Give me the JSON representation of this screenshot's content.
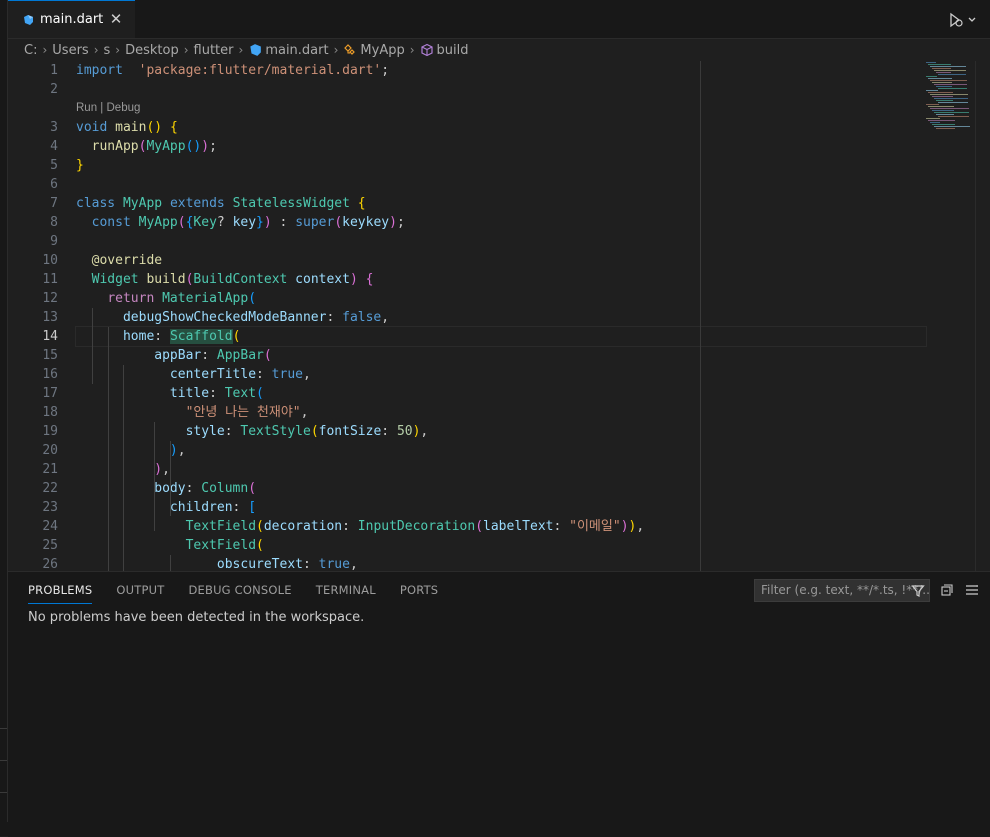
{
  "tab": {
    "label": "main.dart"
  },
  "breadcrumb": [
    "C:",
    "Users",
    "s",
    "Desktop",
    "flutter",
    "main.dart",
    "MyApp",
    "build"
  ],
  "editor": {
    "active_line": 14,
    "codelens": {
      "run": "Run",
      "sep": " | ",
      "debug": "Debug"
    },
    "line_numbers": [
      "1",
      "2",
      "3",
      "4",
      "5",
      "6",
      "7",
      "8",
      "9",
      "10",
      "11",
      "12",
      "13",
      "14",
      "15",
      "16",
      "17",
      "18",
      "19",
      "20",
      "21",
      "22",
      "23",
      "24",
      "25",
      "26"
    ]
  },
  "code": [
    [
      [
        "k",
        "import"
      ],
      [
        "",
        "  "
      ],
      [
        "s",
        "'package:flutter/material.dart'"
      ],
      [
        "",
        ";"
      ]
    ],
    [],
    [
      [
        "k",
        "void"
      ],
      [
        "",
        " "
      ],
      [
        "f",
        "main"
      ],
      [
        "p1",
        "()"
      ],
      [
        "",
        " "
      ],
      [
        "p1",
        "{"
      ]
    ],
    [
      [
        "",
        "  "
      ],
      [
        "f",
        "runApp"
      ],
      [
        "p2",
        "("
      ],
      [
        "t",
        "MyApp"
      ],
      [
        "p3",
        "()"
      ],
      [
        "p2",
        ")"
      ],
      [
        "",
        ";"
      ]
    ],
    [
      [
        "p1",
        "}"
      ]
    ],
    [],
    [
      [
        "k",
        "class"
      ],
      [
        "",
        " "
      ],
      [
        "t",
        "MyApp"
      ],
      [
        "",
        " "
      ],
      [
        "k",
        "extends"
      ],
      [
        "",
        " "
      ],
      [
        "t",
        "StatelessWidget"
      ],
      [
        "",
        " "
      ],
      [
        "p1",
        "{"
      ]
    ],
    [
      [
        "",
        "  "
      ],
      [
        "k",
        "const"
      ],
      [
        "",
        " "
      ],
      [
        "t",
        "MyApp"
      ],
      [
        "p2",
        "("
      ],
      [
        "p3",
        "{"
      ],
      [
        "t",
        "Key"
      ],
      [
        "",
        "? "
      ],
      [
        "v",
        "key"
      ],
      [
        "p3",
        "}"
      ],
      [
        "p2",
        ")"
      ],
      [
        "",
        " : "
      ],
      [
        "k",
        "super"
      ],
      [
        "p2",
        "("
      ],
      [
        "v",
        "key"
      ],
      [
        ": "
      ],
      [
        "v",
        "key"
      ],
      [
        "p2",
        ")"
      ],
      [
        "",
        ";"
      ]
    ],
    [],
    [
      [
        "",
        "  "
      ],
      [
        "an",
        "@override"
      ]
    ],
    [
      [
        "",
        "  "
      ],
      [
        "t",
        "Widget"
      ],
      [
        "",
        " "
      ],
      [
        "f",
        "build"
      ],
      [
        "p2",
        "("
      ],
      [
        "t",
        "BuildContext"
      ],
      [
        "",
        " "
      ],
      [
        "v",
        "context"
      ],
      [
        "p2",
        ")"
      ],
      [
        "",
        " "
      ],
      [
        "p2",
        "{"
      ]
    ],
    [
      [
        "",
        "    "
      ],
      [
        "kc",
        "return"
      ],
      [
        "",
        " "
      ],
      [
        "t",
        "MaterialApp"
      ],
      [
        "p3",
        "("
      ]
    ],
    [
      [
        "",
        "      "
      ],
      [
        "v",
        "debugShowCheckedModeBanner"
      ],
      [
        "",
        ": "
      ],
      [
        "k",
        "false"
      ],
      [
        "",
        ","
      ]
    ],
    [
      [
        "",
        "      "
      ],
      [
        "v",
        "home"
      ],
      [
        "",
        ": "
      ],
      [
        "t hl",
        "Scaffold"
      ],
      [
        "p1",
        "("
      ]
    ],
    [
      [
        "",
        "          "
      ],
      [
        "v",
        "appBar"
      ],
      [
        "",
        ": "
      ],
      [
        "t",
        "AppBar"
      ],
      [
        "p2",
        "("
      ]
    ],
    [
      [
        "",
        "            "
      ],
      [
        "v",
        "centerTitle"
      ],
      [
        "",
        ": "
      ],
      [
        "k",
        "true"
      ],
      [
        "",
        ","
      ]
    ],
    [
      [
        "",
        "            "
      ],
      [
        "v",
        "title"
      ],
      [
        "",
        ": "
      ],
      [
        "t",
        "Text"
      ],
      [
        "p3",
        "("
      ]
    ],
    [
      [
        "",
        "              "
      ],
      [
        "s",
        "\"안녕 나는 천재야\""
      ],
      [
        "",
        ","
      ]
    ],
    [
      [
        "",
        "              "
      ],
      [
        "v",
        "style"
      ],
      [
        "",
        ": "
      ],
      [
        "t",
        "TextStyle"
      ],
      [
        "p1",
        "("
      ],
      [
        "v",
        "fontSize"
      ],
      [
        "",
        ": "
      ],
      [
        "n",
        "50"
      ],
      [
        "p1",
        ")"
      ],
      [
        "",
        ","
      ]
    ],
    [
      [
        "",
        "            "
      ],
      [
        "p3",
        ")"
      ],
      [
        "",
        ","
      ]
    ],
    [
      [
        "",
        "          "
      ],
      [
        "p2",
        ")"
      ],
      [
        "",
        ","
      ]
    ],
    [
      [
        "",
        "          "
      ],
      [
        "v",
        "body"
      ],
      [
        "",
        ": "
      ],
      [
        "t",
        "Column"
      ],
      [
        "p2",
        "("
      ]
    ],
    [
      [
        "",
        "            "
      ],
      [
        "v",
        "children"
      ],
      [
        "",
        ": "
      ],
      [
        "p3",
        "["
      ]
    ],
    [
      [
        "",
        "              "
      ],
      [
        "t",
        "TextField"
      ],
      [
        "p1",
        "("
      ],
      [
        "v",
        "decoration"
      ],
      [
        "",
        ": "
      ],
      [
        "t",
        "InputDecoration"
      ],
      [
        "p2",
        "("
      ],
      [
        "v",
        "labelText"
      ],
      [
        "",
        ": "
      ],
      [
        "s",
        "\"이메일\""
      ],
      [
        "p2",
        ")"
      ],
      [
        "p1",
        ")"
      ],
      [
        "",
        ","
      ]
    ],
    [
      [
        "",
        "              "
      ],
      [
        "t",
        "TextField"
      ],
      [
        "p1",
        "("
      ]
    ],
    [
      [
        "",
        "                  "
      ],
      [
        "v",
        "obscureText"
      ],
      [
        "",
        ": "
      ],
      [
        "k",
        "true"
      ],
      [
        "",
        ","
      ]
    ]
  ],
  "panel": {
    "tabs": [
      "PROBLEMS",
      "OUTPUT",
      "DEBUG CONSOLE",
      "TERMINAL",
      "PORTS"
    ],
    "active_tab": "PROBLEMS",
    "filter_placeholder": "Filter (e.g. text, **/*.ts, !**/...",
    "message": "No problems have been detected in the workspace."
  },
  "icons": {
    "tab": "dart-file-icon",
    "close": "close-icon",
    "run": "run-debug-icon",
    "filter": "filter-icon",
    "collapse": "collapse-all-icon",
    "view": "view-as-list-icon"
  },
  "colors": {
    "accent": "#0078d4",
    "background": "#1f1f1f",
    "panel": "#181818"
  }
}
